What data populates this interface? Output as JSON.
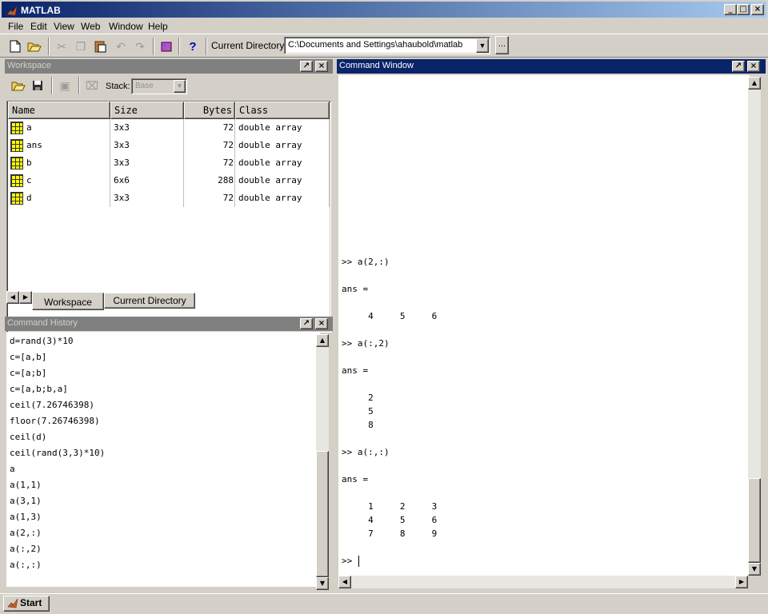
{
  "window": {
    "title": "MATLAB"
  },
  "menu": [
    "File",
    "Edit",
    "View",
    "Web",
    "Window",
    "Help"
  ],
  "toolbar": {
    "current_directory_label": "Current Directory:",
    "current_directory_value": "C:\\Documents and Settings\\ahaubold\\matlab",
    "browse_label": "..."
  },
  "workspace": {
    "title": "Workspace",
    "stack_label": "Stack:",
    "stack_value": "Base",
    "columns": [
      "Name",
      "Size",
      "Bytes",
      "Class"
    ],
    "rows": [
      {
        "name": "a",
        "size": "3x3",
        "bytes": "72",
        "class": "double array"
      },
      {
        "name": "ans",
        "size": "3x3",
        "bytes": "72",
        "class": "double array"
      },
      {
        "name": "b",
        "size": "3x3",
        "bytes": "72",
        "class": "double array"
      },
      {
        "name": "c",
        "size": "6x6",
        "bytes": "288",
        "class": "double array"
      },
      {
        "name": "d",
        "size": "3x3",
        "bytes": "72",
        "class": "double array"
      }
    ],
    "tabs": [
      "Workspace",
      "Current Directory"
    ]
  },
  "history": {
    "title": "Command History",
    "items": [
      "d=rand(3)*10",
      "c=[a,b]",
      "c=[a;b]",
      "c=[a,b;b,a]",
      "ceil(7.26746398)",
      "floor(7.26746398)",
      "ceil(d)",
      "ceil(rand(3,3)*10)",
      "a",
      "a(1,1)",
      "a(3,1)",
      "a(1,3)",
      "a(2,:)",
      "a(:,2)",
      "a(:,:)"
    ]
  },
  "command": {
    "title": "Command Window",
    "lines": [
      ">> a(2,:)",
      "",
      "ans =",
      "",
      "     4     5     6",
      "",
      ">> a(:,2)",
      "",
      "ans =",
      "",
      "     2",
      "     5",
      "     8",
      "",
      ">> a(:,:)",
      "",
      "ans =",
      "",
      "     1     2     3",
      "     4     5     6",
      "     7     8     9",
      "",
      ">> "
    ]
  },
  "status": {
    "start_label": "Start"
  }
}
